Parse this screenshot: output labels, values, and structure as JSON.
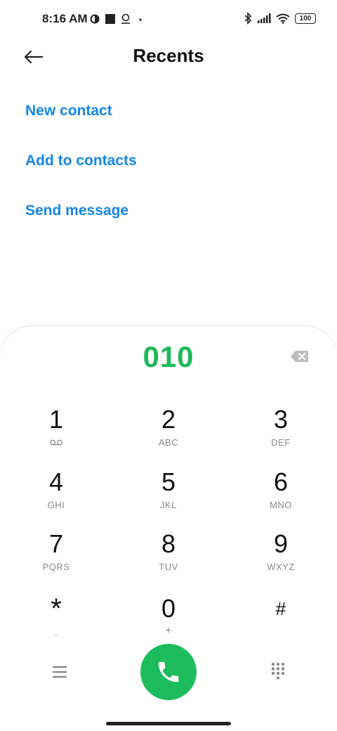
{
  "status_bar": {
    "time": "8:16 AM",
    "battery": "100"
  },
  "header": {
    "title": "Recents"
  },
  "actions": [
    {
      "label": "New contact"
    },
    {
      "label": "Add to contacts"
    },
    {
      "label": "Send message"
    }
  ],
  "dialpad": {
    "number": "010",
    "keys": [
      {
        "digit": "1",
        "letters": ""
      },
      {
        "digit": "2",
        "letters": "ABC"
      },
      {
        "digit": "3",
        "letters": "DEF"
      },
      {
        "digit": "4",
        "letters": "GHI"
      },
      {
        "digit": "5",
        "letters": "JKL"
      },
      {
        "digit": "6",
        "letters": "MNO"
      },
      {
        "digit": "7",
        "letters": "PQRS"
      },
      {
        "digit": "8",
        "letters": "TUV"
      },
      {
        "digit": "9",
        "letters": "WXYZ"
      },
      {
        "digit": "*",
        "letters": ","
      },
      {
        "digit": "0",
        "letters": "+"
      },
      {
        "digit": "#",
        "letters": ""
      }
    ]
  },
  "colors": {
    "accent_blue": "#1487e8",
    "call_green": "#1cbc5c",
    "number_green": "#1cb95a"
  },
  "icons": {
    "voicemail": "voicemail-icon",
    "backspace": "backspace-icon",
    "call": "phone-icon",
    "menu": "menu-icon",
    "dialpad": "dialpad-icon"
  }
}
